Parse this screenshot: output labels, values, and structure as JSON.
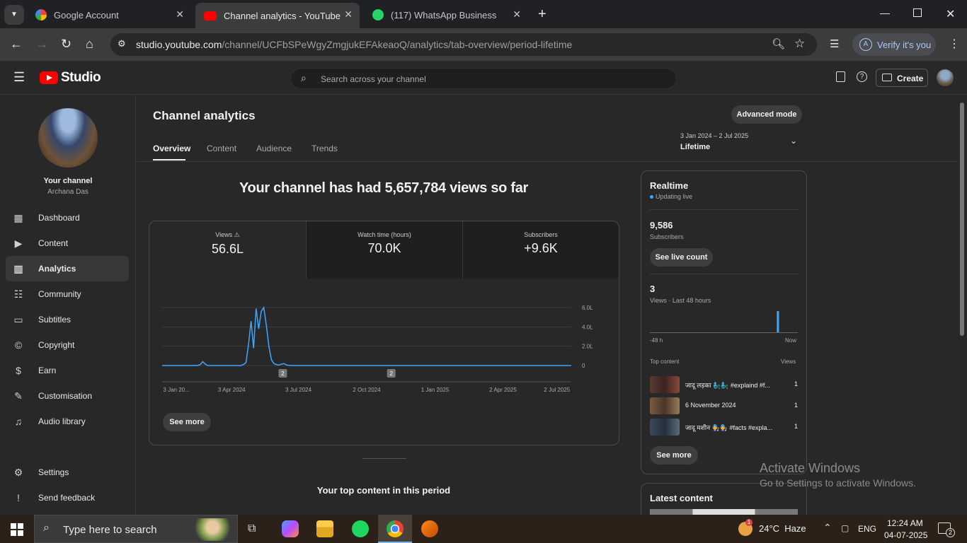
{
  "browser": {
    "tabs": [
      {
        "title": "Google Account"
      },
      {
        "title": "Channel analytics - YouTube Stu"
      },
      {
        "title": "(117) WhatsApp Business"
      }
    ],
    "url_host": "studio.youtube.com",
    "url_path": "/channel/UCFbSPeWgyZmgjukEFAkeaoQ/analytics/tab-overview/period-lifetime",
    "verify_label": "Verify it's you"
  },
  "header": {
    "brand": "Studio",
    "search_placeholder": "Search across your channel",
    "create_label": "Create"
  },
  "sidebar": {
    "channel_label": "Your channel",
    "channel_name": "Archana Das",
    "items": [
      {
        "label": "Dashboard",
        "icon": "dashboard-icon"
      },
      {
        "label": "Content",
        "icon": "content-icon"
      },
      {
        "label": "Analytics",
        "icon": "analytics-icon"
      },
      {
        "label": "Community",
        "icon": "community-icon"
      },
      {
        "label": "Subtitles",
        "icon": "subtitles-icon"
      },
      {
        "label": "Copyright",
        "icon": "copyright-icon"
      },
      {
        "label": "Earn",
        "icon": "earn-icon"
      },
      {
        "label": "Customisation",
        "icon": "customisation-icon"
      },
      {
        "label": "Audio library",
        "icon": "audio-library-icon"
      }
    ],
    "settings_label": "Settings",
    "feedback_label": "Send feedback"
  },
  "main": {
    "title": "Channel analytics",
    "advanced_mode_label": "Advanced mode",
    "tabs": [
      "Overview",
      "Content",
      "Audience",
      "Trends"
    ],
    "period_range": "3 Jan 2024 – 2 Jul 2025",
    "period_label": "Lifetime",
    "headline": "Your channel has had 5,657,784 views so far",
    "metrics": [
      {
        "label": "Views",
        "value": "56.6L"
      },
      {
        "label": "Watch time (hours)",
        "value": "70.0K"
      },
      {
        "label": "Subscribers",
        "value": "+9.6K"
      }
    ],
    "see_more_label": "See more",
    "top_content_heading": "Your top content in this period"
  },
  "chart_data": {
    "type": "line",
    "x_ticks": [
      "3 Jan 20...",
      "3 Apr 2024",
      "3 Jul 2024",
      "2 Oct 2024",
      "1 Jan 2025",
      "2 Apr 2025",
      "2 Jul 2025"
    ],
    "y_ticks": [
      "6.0L",
      "4.0L",
      "2.0L",
      "0"
    ],
    "ylim": [
      0,
      600000
    ],
    "markers": [
      "2",
      "2"
    ],
    "series": [
      {
        "values": [
          0,
          0,
          0,
          0,
          0,
          0,
          0,
          0,
          0,
          0,
          0,
          0,
          0,
          2000,
          0,
          10000,
          40000,
          15000,
          0,
          0,
          0,
          0,
          0,
          0,
          0,
          0,
          0,
          0,
          0,
          0,
          0,
          0,
          10000,
          30000,
          220000,
          460000,
          180000,
          590000,
          380000,
          560000,
          600000,
          420000,
          200000,
          60000,
          20000,
          10000,
          5000,
          15000,
          20000,
          5000,
          2000,
          0,
          0,
          0,
          0,
          0,
          0,
          0,
          0,
          0,
          0,
          0,
          0,
          0,
          0,
          0,
          0,
          0,
          0,
          0,
          0,
          0,
          0,
          0,
          0,
          0,
          0,
          0,
          0,
          0,
          0,
          0,
          0,
          0,
          0,
          0,
          0,
          0,
          0,
          0,
          0,
          0,
          0,
          0,
          0,
          0,
          0,
          0,
          0,
          0,
          0,
          0,
          0,
          0,
          0,
          0,
          0,
          0,
          0,
          0,
          0,
          0,
          0,
          0,
          0,
          0,
          0,
          0,
          0,
          0,
          0,
          0,
          0,
          0,
          0,
          0,
          0,
          0,
          0,
          0,
          0,
          0,
          0,
          0,
          0,
          0,
          0,
          0,
          0,
          0,
          0,
          0,
          0,
          0,
          0,
          0,
          0,
          0,
          0,
          0,
          0,
          0,
          0,
          0,
          0,
          0,
          0,
          0,
          0,
          0,
          0,
          0
        ]
      }
    ]
  },
  "realtime": {
    "title": "Realtime",
    "status": "Updating live",
    "subscribers_value": "9,586",
    "subscribers_label": "Subscribers",
    "see_live_label": "See live count",
    "views_value": "3",
    "views_label": "Views · Last 48 hours",
    "spark_start": "-48 h",
    "spark_end": "Now",
    "spark_values": [
      0,
      0,
      0,
      0,
      0,
      0,
      0,
      0,
      0,
      0,
      0,
      0,
      0,
      0,
      0,
      0,
      0,
      0,
      0,
      0,
      0,
      0,
      0,
      0,
      0,
      0,
      0,
      0,
      0,
      0,
      0,
      0,
      0,
      0,
      0,
      0,
      0,
      0,
      0,
      0,
      0,
      3,
      0,
      0,
      0,
      0,
      0,
      0
    ],
    "top_content_label": "Top content",
    "views_col_label": "Views",
    "top_items": [
      {
        "title": "जादू लड़का 🧞‍♂️🧞‍♂️ #explaind #f...",
        "views": "1"
      },
      {
        "title": "6 November 2024",
        "views": "1"
      },
      {
        "title": "जादू मशीन 🧑‍🔧🧑‍🔧 #facts #expla...",
        "views": "1"
      }
    ],
    "see_more_label": "See more",
    "latest_content_label": "Latest content"
  },
  "watermark": {
    "line1": "Activate Windows",
    "line2": "Go to Settings to activate Windows."
  },
  "taskbar": {
    "search_placeholder": "Type here to search",
    "weather": "24°C  Haze",
    "weather_badge": "1",
    "lang": "ENG",
    "time": "12:24 AM",
    "date": "04-07-2025",
    "notif_count": "2"
  },
  "colors": {
    "accent_line": "#3ea6ff",
    "youtube_red": "#ff0000",
    "background": "#282828"
  }
}
